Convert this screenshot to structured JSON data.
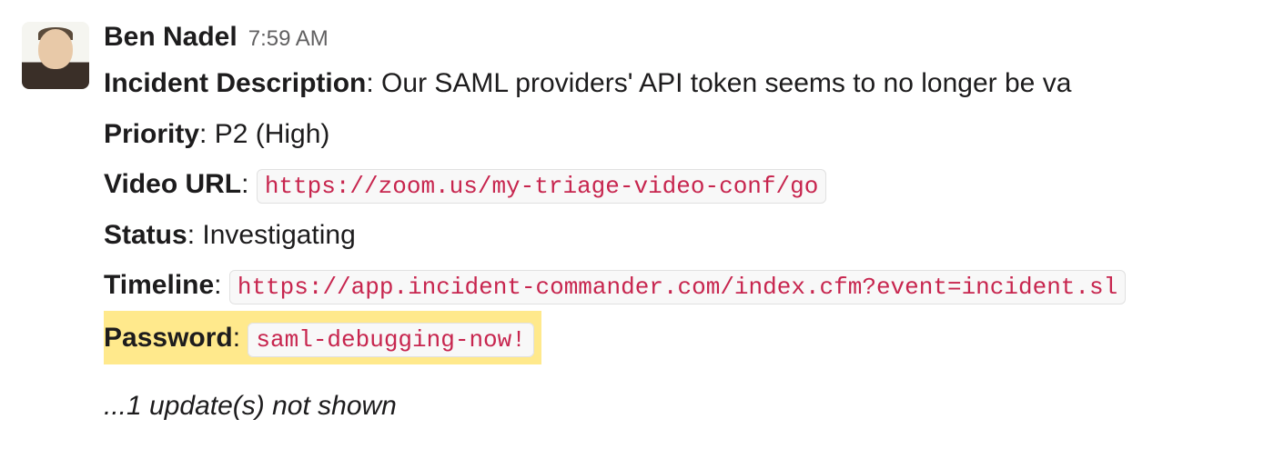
{
  "message": {
    "author": "Ben Nadel",
    "timestamp": "7:59 AM",
    "fields": {
      "incident_description": {
        "label": "Incident Description",
        "value": "Our SAML providers' API token seems to no longer be va"
      },
      "priority": {
        "label": "Priority",
        "value": "P2 (High)"
      },
      "video_url": {
        "label": "Video URL",
        "value": "https://zoom.us/my-triage-video-conf/go"
      },
      "status": {
        "label": "Status",
        "value": "Investigating"
      },
      "timeline": {
        "label": "Timeline",
        "value": "https://app.incident-commander.com/index.cfm?event=incident.sl"
      },
      "password": {
        "label": "Password",
        "value": "saml-debugging-now!"
      }
    },
    "updates_note": "...1 update(s) not shown"
  }
}
